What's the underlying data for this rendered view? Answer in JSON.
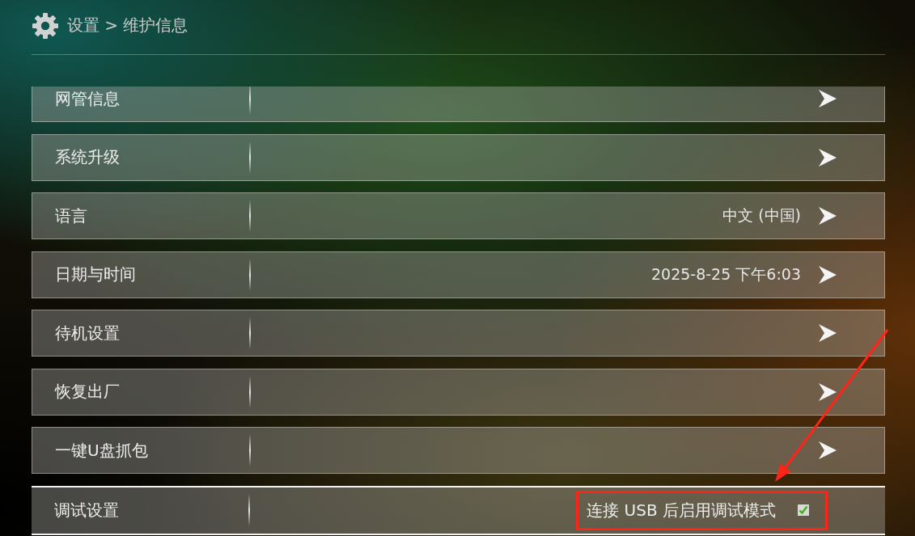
{
  "header": {
    "breadcrumb": "设置 > 维护信息"
  },
  "items": [
    {
      "label": "网管信息",
      "kind": "submenu",
      "selected": false
    },
    {
      "label": "系统升级",
      "kind": "submenu",
      "selected": false
    },
    {
      "label": "语言",
      "value": "中文 (中国)",
      "kind": "submenu",
      "selected": false
    },
    {
      "label": "日期与时间",
      "value": "2025-8-25 下午6:03",
      "kind": "submenu",
      "selected": false
    },
    {
      "label": "待机设置",
      "kind": "submenu",
      "selected": false
    },
    {
      "label": "恢复出厂",
      "kind": "submenu",
      "selected": false
    },
    {
      "label": "一键U盘抓包",
      "kind": "submenu",
      "selected": false
    },
    {
      "label": "调试设置",
      "kind": "checkbox",
      "option": "连接 USB 后启用调试模式",
      "checked": true,
      "highlighted": true,
      "selected": true
    }
  ]
}
